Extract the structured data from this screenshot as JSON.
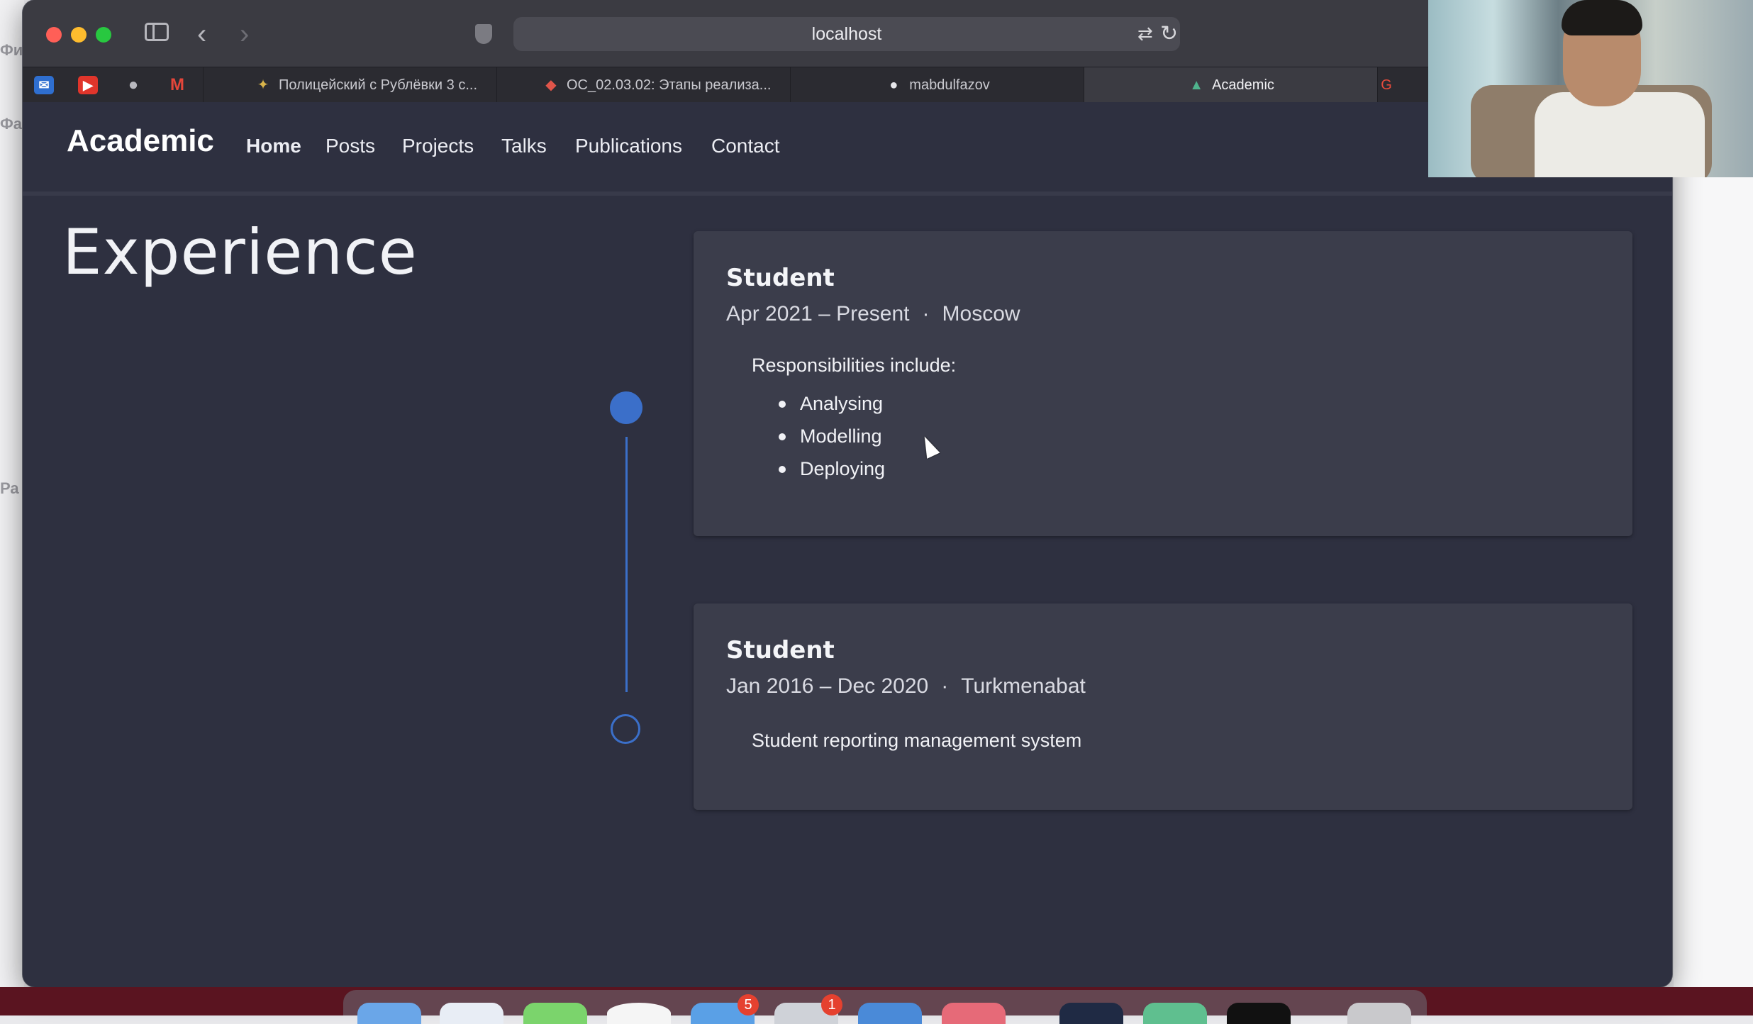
{
  "background_left": {
    "texts": [
      "Фи",
      "Фа",
      "Ра"
    ]
  },
  "browser": {
    "url": "localhost",
    "tabs": [
      {
        "title": "Полицейский с Рублёвки 3 с...",
        "icon": "star-icon"
      },
      {
        "title": "ОС_02.03.02: Этапы реализа...",
        "icon": "app-icon"
      },
      {
        "title": "mabdulfazov",
        "icon": "github-icon"
      },
      {
        "title": "Academic",
        "icon": "academic-icon",
        "active": true
      },
      {
        "title": "",
        "icon": "google-icon"
      }
    ],
    "favorites": [
      "mail-icon",
      "youtube-icon",
      "apple-icon",
      "gmail-icon"
    ]
  },
  "site": {
    "brand": "Academic",
    "nav": {
      "home": "Home",
      "posts": "Posts",
      "projects": "Projects",
      "talks": "Talks",
      "publications": "Publications",
      "contact": "Contact"
    },
    "section_title": "Experience",
    "accent_color": "#3b6fc9",
    "experience": [
      {
        "title": "Student",
        "dates": "Apr 2021 – Present",
        "separator": "·",
        "location": "Moscow",
        "description": "Responsibilities include:",
        "bullets": [
          "Analysing",
          "Modelling",
          "Deploying"
        ]
      },
      {
        "title": "Student",
        "dates": "Jan 2016 – Dec 2020",
        "separator": "·",
        "location": "Turkmenabat",
        "description": "Student reporting management system"
      }
    ]
  },
  "dock": {
    "badges": [
      "5",
      "1"
    ]
  }
}
